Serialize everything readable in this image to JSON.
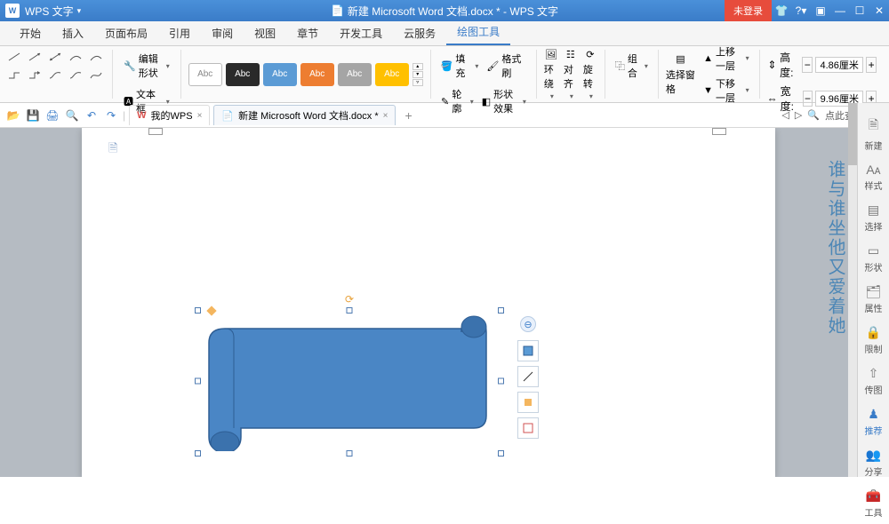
{
  "app": {
    "icon": "W",
    "name": "WPS 文字",
    "doc_title": "新建 Microsoft Word 文档.docx * - WPS 文字"
  },
  "title_controls": {
    "login": "未登录"
  },
  "menu": {
    "tabs": [
      "开始",
      "插入",
      "页面布局",
      "引用",
      "审阅",
      "视图",
      "章节",
      "开发工具",
      "云服务",
      "绘图工具"
    ],
    "active": 9
  },
  "ribbon": {
    "edit_shape": "编辑形状",
    "text_box": "文本框",
    "style_label": "Abc",
    "fill": "填充",
    "format_painter": "格式刷",
    "outline": "轮廓",
    "shape_effect": "形状效果",
    "wrap": "环绕",
    "align": "对齐",
    "rotate": "旋转",
    "group": "组合",
    "select_pane": "选择窗格",
    "bring_fwd": "上移一层",
    "send_back": "下移一层",
    "height_label": "高度:",
    "width_label": "宽度:",
    "height_val": "4.86厘米",
    "width_val": "9.96厘米"
  },
  "doc_tabs": {
    "wps": "我的WPS",
    "active": "新建 Microsoft Word 文档.docx *"
  },
  "search": {
    "placeholder": "点此查找命令"
  },
  "sidebar": {
    "items": [
      "新建",
      "样式",
      "选择",
      "形状",
      "属性",
      "限制",
      "传图",
      "推荐",
      "分享",
      "工具"
    ],
    "active": 7
  },
  "watermark": "谁与谁坐他又爱着她"
}
